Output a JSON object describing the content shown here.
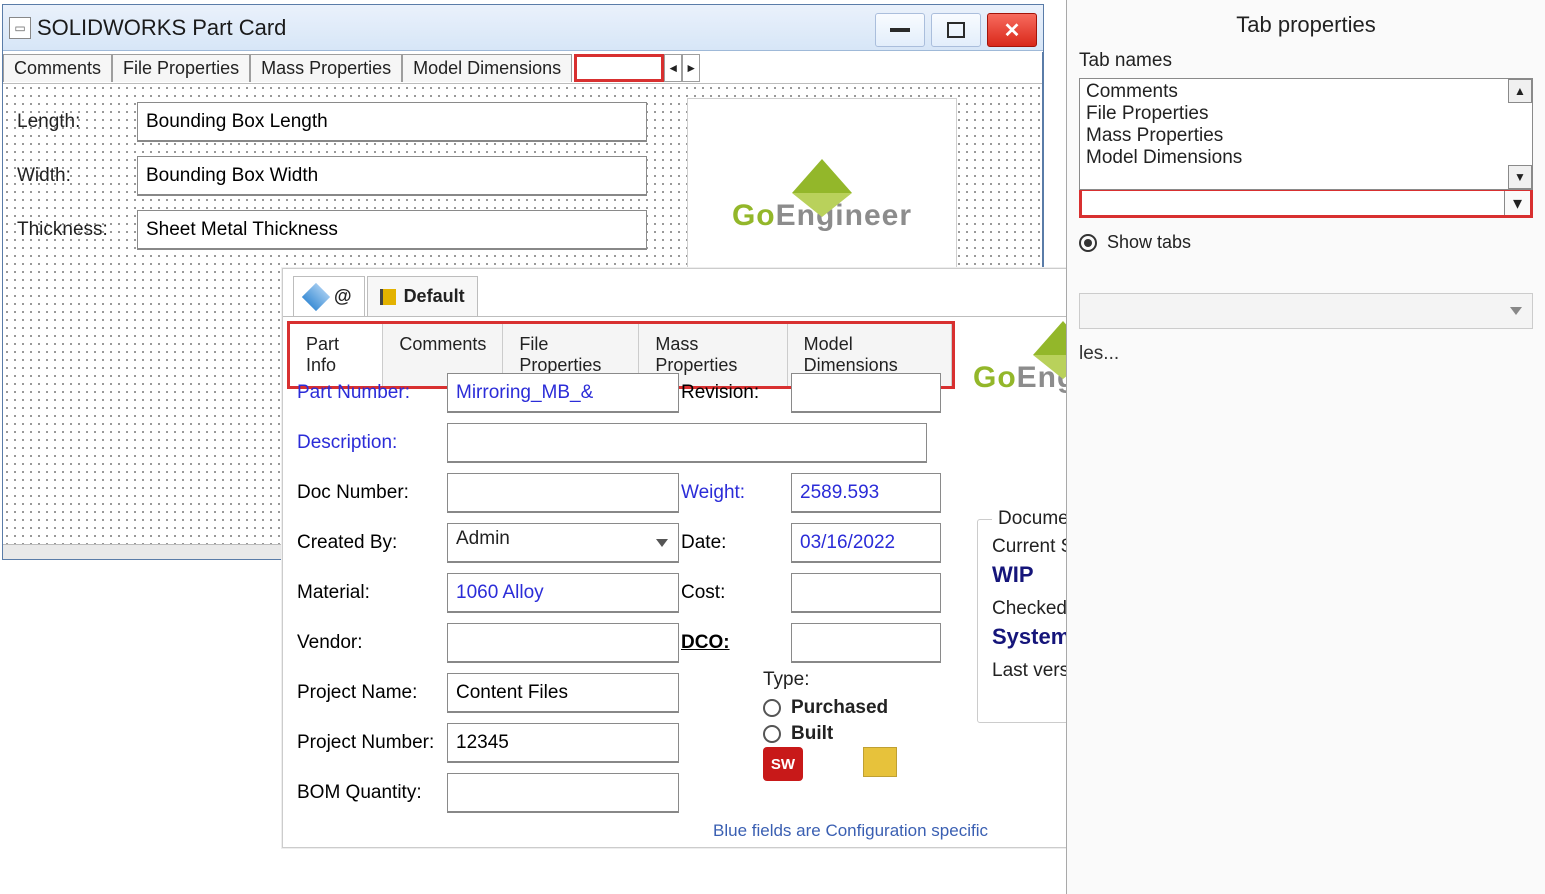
{
  "window": {
    "title": "SOLIDWORKS Part Card"
  },
  "tabstrip": {
    "tabs": [
      "Comments",
      "File Properties",
      "Mass Properties",
      "Model Dimensions"
    ],
    "scroll_left": "◄",
    "scroll_right": "►"
  },
  "card_fields": {
    "length_label": "Length:",
    "length_value": "Bounding Box Length",
    "width_label": "Width:",
    "width_value": "Bounding Box Width",
    "thickness_label": "Thickness:",
    "thickness_value": "Sheet Metal Thickness"
  },
  "logo": {
    "go": "Go",
    "eng": "Engineer"
  },
  "preview": {
    "top_at": "@",
    "top_default": "Default",
    "tabs": [
      "Part Info",
      "Comments",
      "File Properties",
      "Mass Properties",
      "Model Dimensions"
    ],
    "part_number_label": "Part Number:",
    "part_number_value": "Mirroring_MB_&",
    "revision_label": "Revision:",
    "description_label": "Description:",
    "doc_number_label": "Doc Number:",
    "weight_label": "Weight:",
    "weight_value": "2589.593",
    "created_by_label": "Created By:",
    "created_by_value": "Admin",
    "date_label": "Date:",
    "date_value": "03/16/2022",
    "material_label": "Material:",
    "material_value": "1060 Alloy",
    "cost_label": "Cost:",
    "vendor_label": "Vendor:",
    "dco_label": "DCO:",
    "project_name_label": "Project Name:",
    "project_name_value": "Content Files",
    "type_label": "Type:",
    "type_purchased": "Purchased",
    "type_built": "Built",
    "project_number_label": "Project Number:",
    "project_number_value": "12345",
    "bom_label": "BOM Quantity:",
    "config_note": "Blue fields are Configuration specific",
    "sw_icon_text": "SW"
  },
  "status": {
    "box_title": "Document Status",
    "current_state_label": "Current State:",
    "current_state_value": "WIP",
    "checked_out_label": "Checked out by:",
    "checked_out_value": "System Administrator",
    "last_comment_label": "Last version comment:"
  },
  "props": {
    "panel_title": "Tab properties",
    "tab_names_label": "Tab names",
    "tab_names": [
      "Comments",
      "File Properties",
      "Mass Properties",
      "Model Dimensions"
    ],
    "show_tabs_label": "Show tabs",
    "truncated_hint": "les..."
  }
}
